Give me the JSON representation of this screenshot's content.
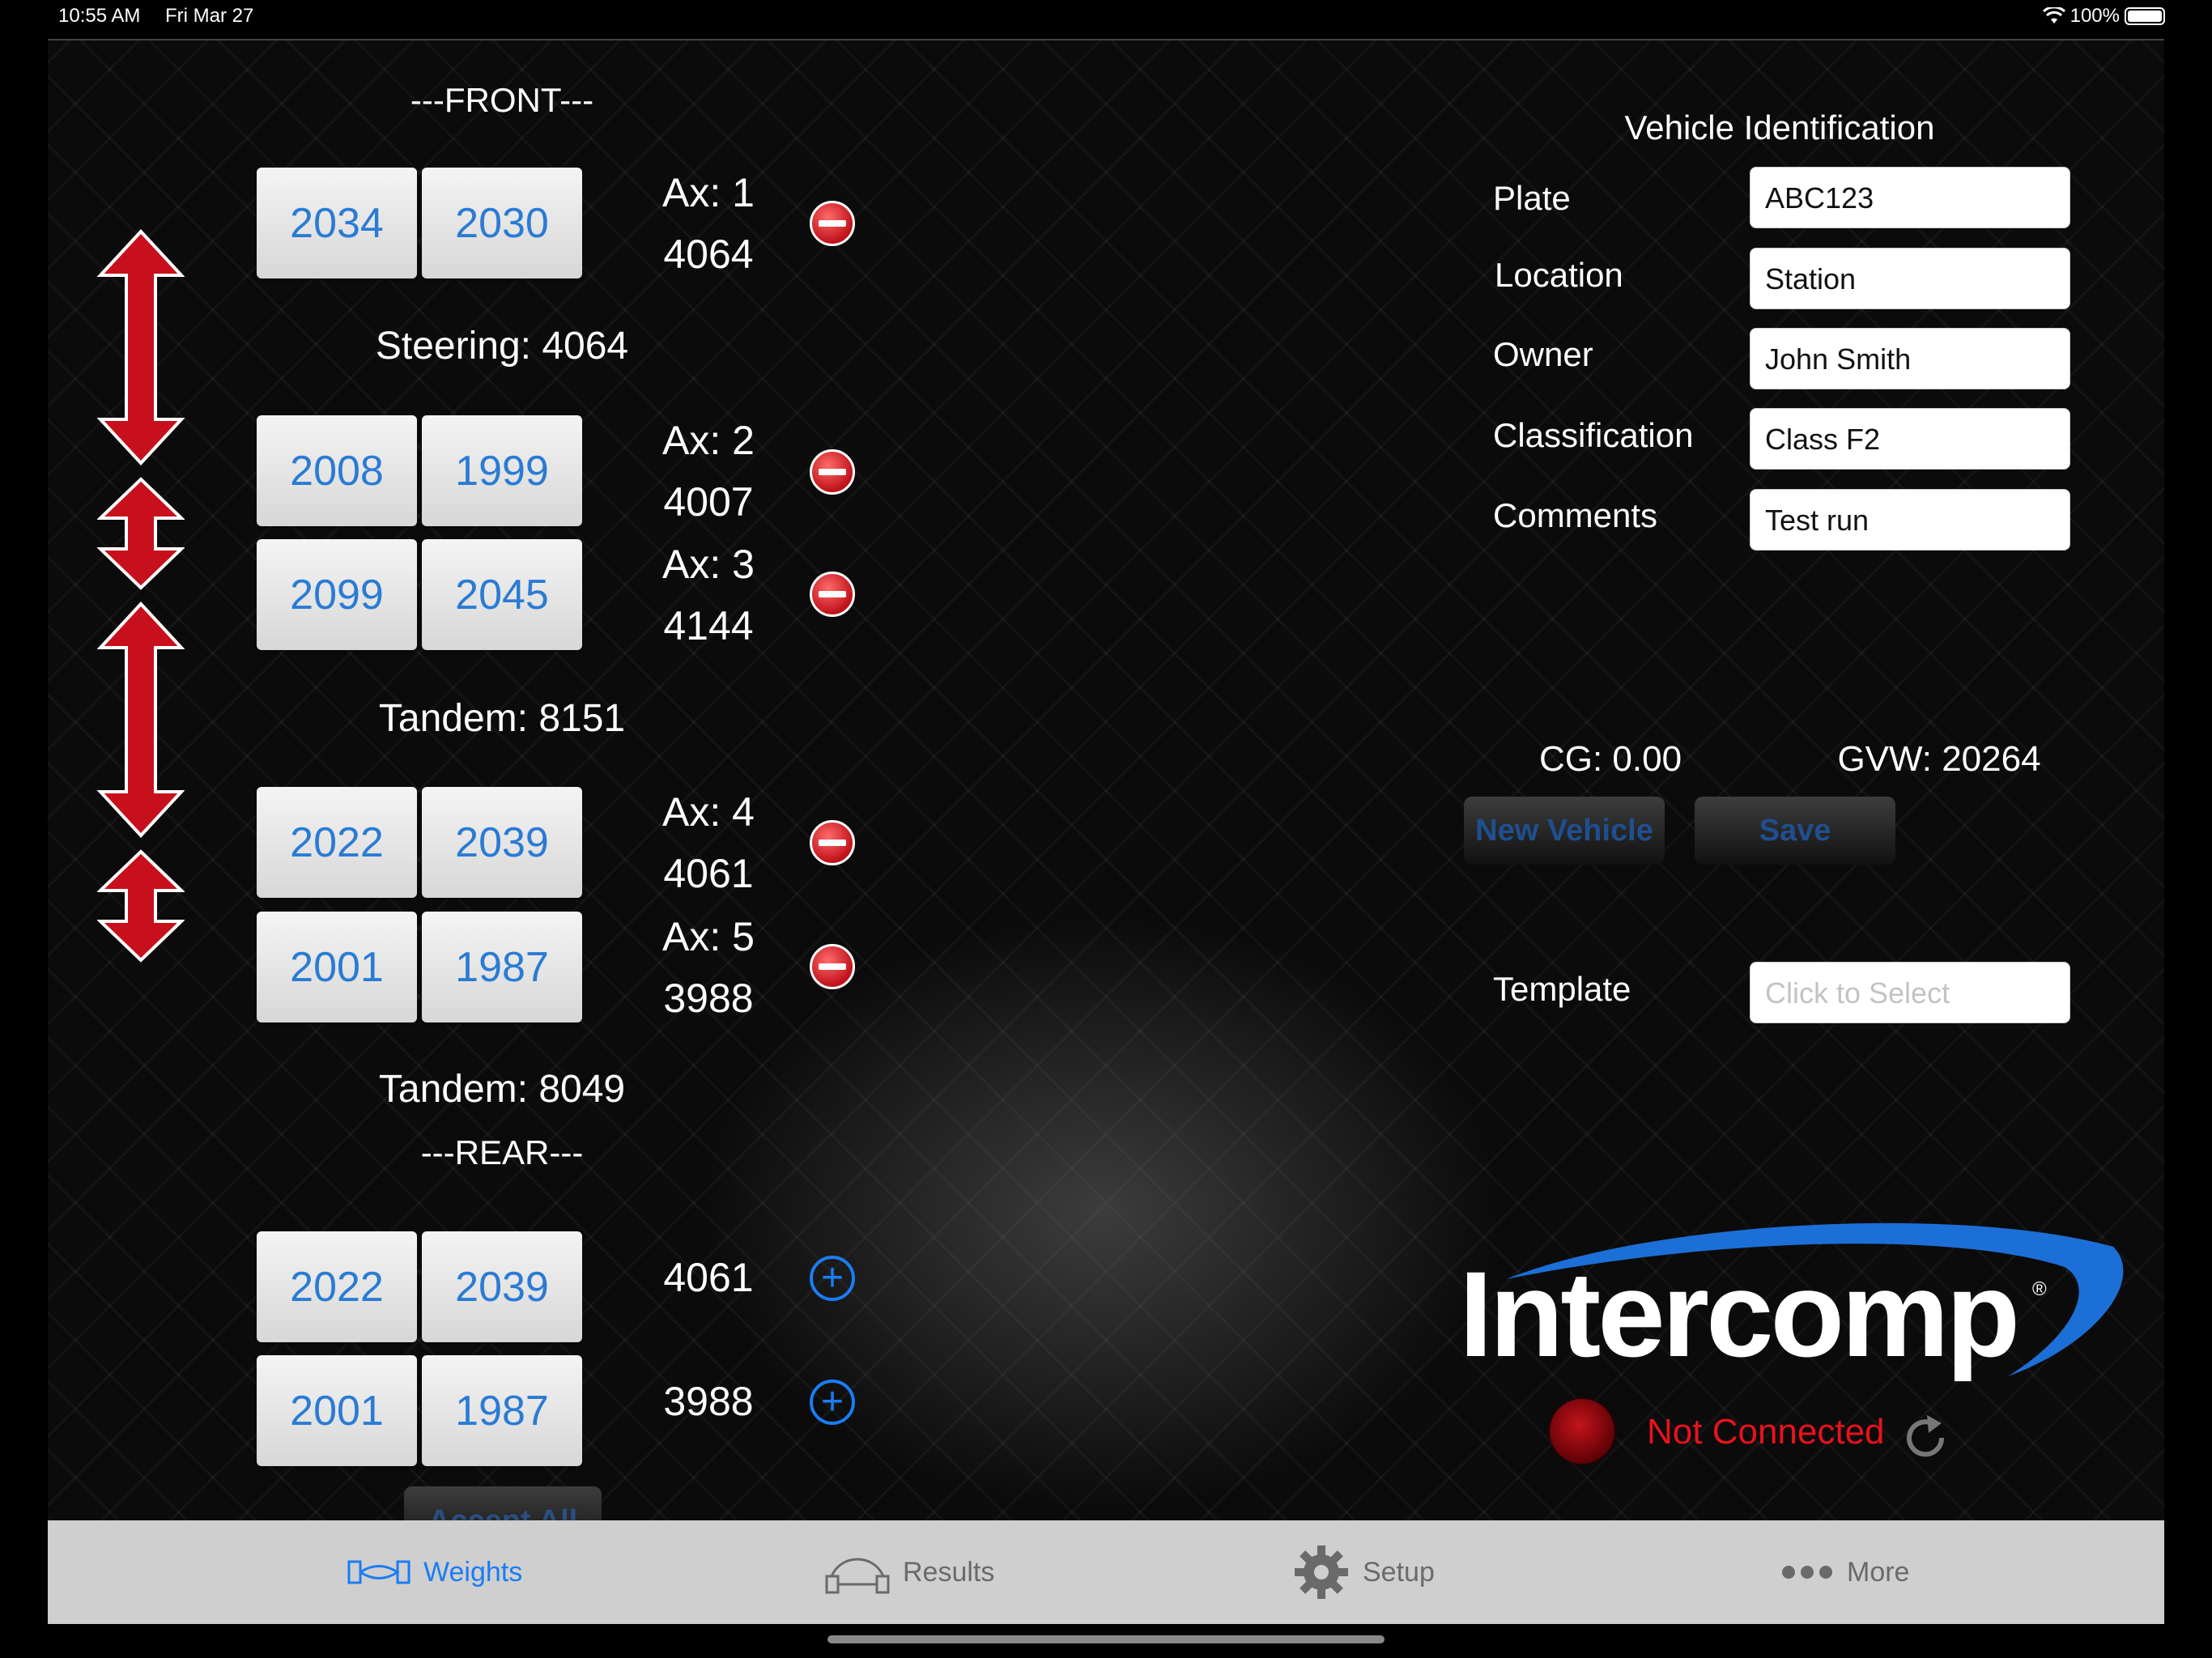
{
  "status_bar": {
    "time": "10:55 AM",
    "date": "Fri Mar 27",
    "battery": "100%"
  },
  "weights": {
    "front_label": "---FRONT---",
    "rear_label": "---REAR---",
    "axles": [
      {
        "left": "2034",
        "right": "2030",
        "axle": "Ax: 1",
        "total": "4064"
      },
      {
        "left": "2008",
        "right": "1999",
        "axle": "Ax: 2",
        "total": "4007"
      },
      {
        "left": "2099",
        "right": "2045",
        "axle": "Ax: 3",
        "total": "4144"
      },
      {
        "left": "2022",
        "right": "2039",
        "axle": "Ax: 4",
        "total": "4061"
      },
      {
        "left": "2001",
        "right": "1987",
        "axle": "Ax: 5",
        "total": "3988"
      }
    ],
    "groups": [
      "Steering: 4064",
      "Tandem: 8151",
      "Tandem: 8049"
    ],
    "available": [
      {
        "left": "2022",
        "right": "2039",
        "total": "4061"
      },
      {
        "left": "2001",
        "right": "1987",
        "total": "3988"
      }
    ],
    "accept_all": "Accept All"
  },
  "vehicle": {
    "title": "Vehicle Identification",
    "fields": [
      {
        "label": "Plate",
        "value": "ABC123"
      },
      {
        "label": "Location",
        "value": "Station"
      },
      {
        "label": "Owner",
        "value": "John Smith"
      },
      {
        "label": "Classification",
        "value": "Class F2"
      },
      {
        "label": "Comments",
        "value": "Test run"
      }
    ],
    "cg": "CG: 0.00",
    "gvw": "GVW: 20264",
    "new_vehicle": "New Vehicle",
    "save": "Save",
    "template_label": "Template",
    "template_placeholder": "Click to Select"
  },
  "brand": {
    "name": "Intercomp",
    "reg": "®"
  },
  "connection": {
    "status": "Not Connected",
    "status_color": "#e8121b"
  },
  "tabs": [
    {
      "label": "Weights",
      "icon": "weights-icon"
    },
    {
      "label": "Results",
      "icon": "results-icon"
    },
    {
      "label": "Setup",
      "icon": "gear-icon"
    },
    {
      "label": "More",
      "icon": "more-icon"
    }
  ],
  "colors": {
    "accent": "#1a7cf5",
    "arrow": "#c8101c",
    "tab_bar": "#cfcfcf"
  }
}
